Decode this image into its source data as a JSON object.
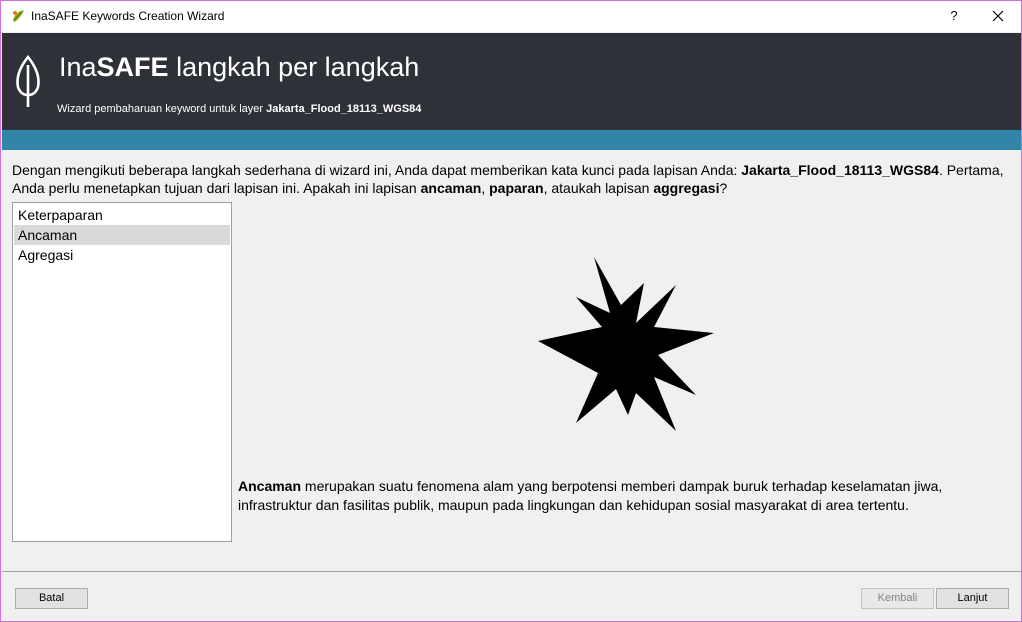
{
  "window": {
    "title": "InaSAFE Keywords Creation Wizard",
    "help_label": "?",
    "icon": "qgis-icon",
    "close_icon": "close-icon"
  },
  "header": {
    "title_prefix": "Ina",
    "title_bold": "SAFE",
    "title_suffix": " langkah per langkah",
    "subtitle_prefix": "Wizard pembaharuan keyword untuk layer ",
    "layer_name": "Jakarta_Flood_18113_WGS84",
    "logo_icon": "inasafe-leaf-icon",
    "accent_color": "#3285a8",
    "banner_color": "#2e3137"
  },
  "intro": {
    "t1": "Dengan mengikuti beberapa langkah sederhana di wizard ini, Anda dapat memberikan kata kunci pada lapisan Anda: ",
    "layer": "Jakarta_Flood_18113_WGS84",
    "t2": ". Pertama, Anda perlu menetapkan tujuan dari lapisan ini. Apakah ini lapisan ",
    "b1": "ancaman",
    "t3": ", ",
    "b2": "paparan",
    "t4": ", ataukah lapisan ",
    "b3": "aggregasi",
    "t5": "?"
  },
  "categories": {
    "items": [
      "Keterpaparan",
      "Ancaman",
      "Agregasi"
    ],
    "selected": "Ancaman"
  },
  "illustration": {
    "icon": "hazard-starburst-icon"
  },
  "description": {
    "term": "Ancaman",
    "text": " merupakan suatu fenomena alam yang berpotensi memberi dampak buruk terhadap keselamatan jiwa, infrastruktur dan fasilitas publik, maupun pada lingkungan dan kehidupan sosial masyarakat di area tertentu."
  },
  "footer": {
    "cancel_label": "Batal",
    "back_label": "Kembali",
    "next_label": "Lanjut"
  }
}
